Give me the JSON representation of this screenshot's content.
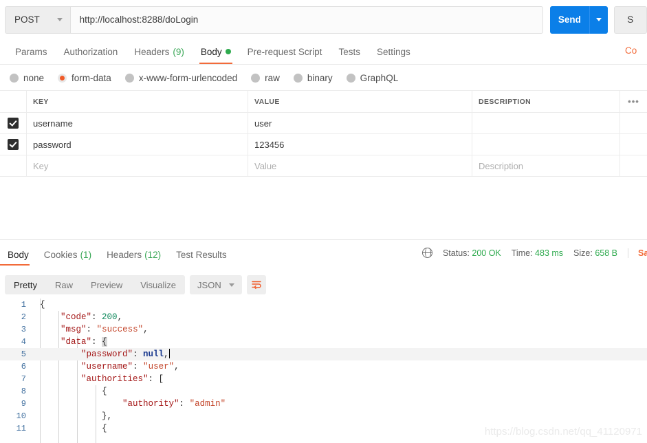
{
  "request": {
    "method": "POST",
    "url": "http://localhost:8288/doLogin",
    "send_label": "Send",
    "save_label": "S",
    "cookies_link": "Co",
    "tabs": [
      {
        "label": "Params",
        "count": "",
        "dot": false
      },
      {
        "label": "Authorization",
        "count": "",
        "dot": false
      },
      {
        "label": "Headers",
        "count": "(9)",
        "dot": false
      },
      {
        "label": "Body",
        "count": "",
        "dot": true
      },
      {
        "label": "Pre-request Script",
        "count": "",
        "dot": false
      },
      {
        "label": "Tests",
        "count": "",
        "dot": false
      },
      {
        "label": "Settings",
        "count": "",
        "dot": false
      }
    ],
    "body_types": [
      {
        "label": "none",
        "selected": false
      },
      {
        "label": "form-data",
        "selected": true
      },
      {
        "label": "x-www-form-urlencoded",
        "selected": false
      },
      {
        "label": "raw",
        "selected": false
      },
      {
        "label": "binary",
        "selected": false
      },
      {
        "label": "GraphQL",
        "selected": false
      }
    ],
    "table": {
      "headers": {
        "key": "KEY",
        "value": "VALUE",
        "description": "DESCRIPTION",
        "menu": "•••"
      },
      "rows": [
        {
          "checked": true,
          "key": "username",
          "value": "user",
          "description": ""
        },
        {
          "checked": true,
          "key": "password",
          "value": "123456",
          "description": ""
        }
      ],
      "placeholder_row": {
        "key": "Key",
        "value": "Value",
        "description": "Description"
      }
    }
  },
  "response": {
    "tabs": [
      {
        "label": "Body",
        "count": ""
      },
      {
        "label": "Cookies",
        "count": "(1)"
      },
      {
        "label": "Headers",
        "count": "(12)"
      },
      {
        "label": "Test Results",
        "count": ""
      }
    ],
    "meta": {
      "status_label": "Status:",
      "status_value": "200 OK",
      "time_label": "Time:",
      "time_value": "483 ms",
      "size_label": "Size:",
      "size_value": "658 B",
      "save_response": "Save R"
    },
    "view_modes": [
      "Pretty",
      "Raw",
      "Preview",
      "Visualize"
    ],
    "active_view": "Pretty",
    "format": "JSON",
    "code_lines": [
      {
        "n": "1",
        "active": false
      },
      {
        "n": "2",
        "active": false
      },
      {
        "n": "3",
        "active": false
      },
      {
        "n": "4",
        "active": false
      },
      {
        "n": "5",
        "active": true
      },
      {
        "n": "6",
        "active": false
      },
      {
        "n": "7",
        "active": false
      },
      {
        "n": "8",
        "active": false
      },
      {
        "n": "9",
        "active": false
      },
      {
        "n": "10",
        "active": false
      },
      {
        "n": "11",
        "active": false
      }
    ],
    "json_body": {
      "code": 200,
      "msg": "success",
      "data": {
        "password": null,
        "username": "user",
        "authorities": [
          {
            "authority": "admin"
          }
        ]
      }
    }
  },
  "watermark": "https://blog.csdn.net/qq_41120971",
  "colors": {
    "accent_orange": "#f26b3a",
    "send_blue": "#0b7fe8",
    "success_green": "#2eaa4e",
    "radio_orange": "#f05a28"
  }
}
